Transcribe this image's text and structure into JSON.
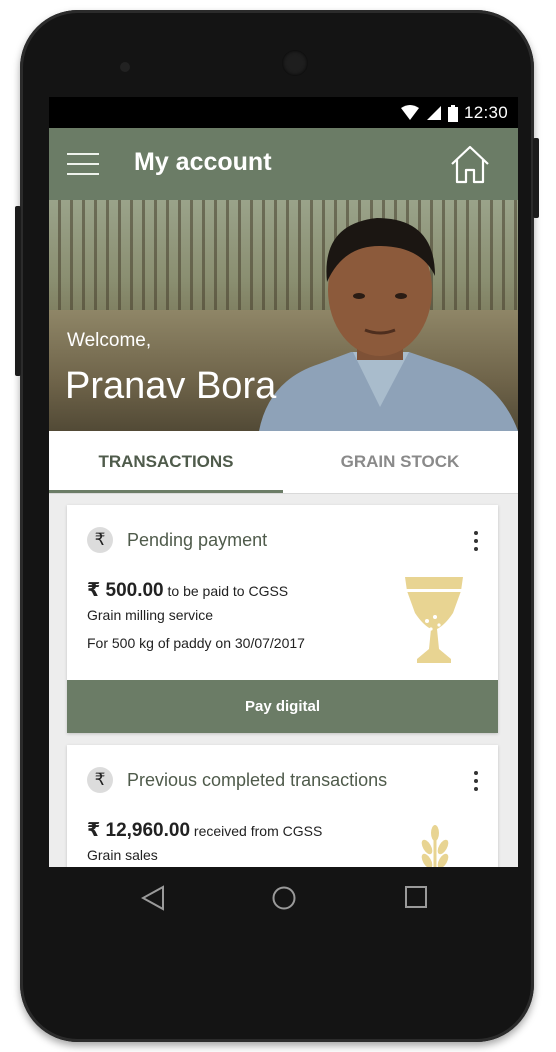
{
  "status_bar": {
    "time": "12:30"
  },
  "app_bar": {
    "title": "My account"
  },
  "hero": {
    "welcome": "Welcome,",
    "user_name": "Pranav Bora"
  },
  "tabs": [
    {
      "label": "TRANSACTIONS",
      "active": true
    },
    {
      "label": "GRAIN STOCK",
      "active": false
    }
  ],
  "pending_card": {
    "heading": "Pending payment",
    "currency_symbol": "₹",
    "amount": "₹ 500.00",
    "amount_suffix": "to be paid to CGSS",
    "service": "Grain milling service",
    "detail": "For 500 kg of paddy on 30/07/2017",
    "action_label": "Pay digital"
  },
  "completed_card": {
    "heading": "Previous completed transactions",
    "currency_symbol": "₹",
    "amount": "₹ 12,960.00",
    "amount_suffix": "received from CGSS",
    "category": "Grain sales"
  },
  "colors": {
    "primary": "#6b7c66",
    "icon_gold": "#e8d492",
    "tab_active": "#4f5b4b"
  },
  "icons": {
    "menu": "hamburger-menu-icon",
    "home": "home-icon",
    "milling": "grain-mill-icon",
    "wheat": "wheat-icon",
    "back": "back-triangle-icon",
    "home_nav": "home-circle-icon",
    "recents": "recents-square-icon"
  }
}
